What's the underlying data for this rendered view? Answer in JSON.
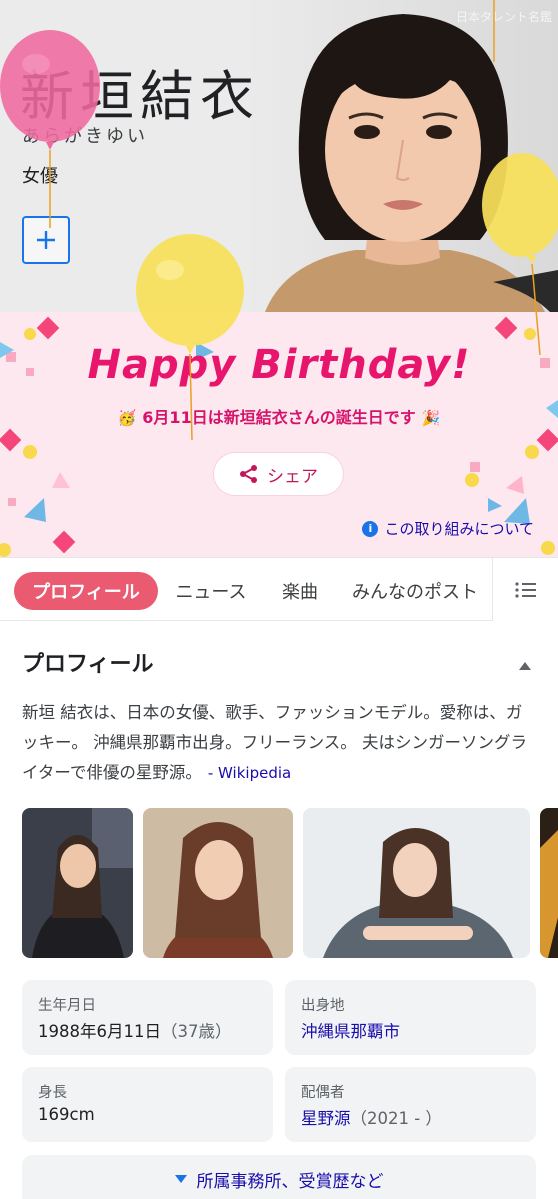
{
  "hero": {
    "name": "新垣結衣",
    "kana": "あらがきゆい",
    "occupation": "女優",
    "image_credit": "日本タレント名鑑",
    "follow_icon": "plus-icon"
  },
  "birthday": {
    "title": "Happy Birthday!",
    "message": "6月11日は新垣結衣さんの誕生日です",
    "left_emoji": "🥳",
    "right_emoji": "🎉",
    "share_label": "シェア",
    "about_label": "この取り組みについて",
    "colors": {
      "accent": "#e8156c",
      "background": "#fde8ef"
    }
  },
  "tabs": {
    "items": [
      {
        "label": "プロフィール",
        "active": true
      },
      {
        "label": "ニュース"
      },
      {
        "label": "楽曲"
      },
      {
        "label": "みんなのポスト"
      }
    ],
    "more_icon": "list-icon"
  },
  "profile": {
    "title": "プロフィール",
    "description": "新垣 結衣は、日本の女優、歌手、ファッションモデル。愛称は、ガッキー。 沖縄県那覇市出身。フリーランス。 夫はシンガーソングライターで俳優の星野源。",
    "source": "Wikipedia",
    "facts": {
      "birth": {
        "label": "生年月日",
        "value": "1988年6月11日",
        "sub": "（37歳）"
      },
      "origin": {
        "label": "出身地",
        "value": "沖縄県那覇市"
      },
      "height": {
        "label": "身長",
        "value": "169cm"
      },
      "spouse": {
        "label": "配偶者",
        "value": "星野源",
        "sub": "（2021 - ）"
      }
    },
    "more_label": "所属事務所、受賞歴など"
  }
}
